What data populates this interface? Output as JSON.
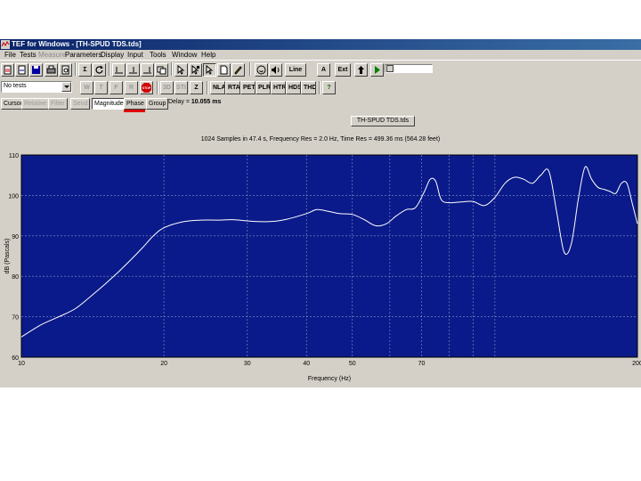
{
  "title_bar": {
    "text": "TEF for Windows - [TH-SPUD TDS.tds]"
  },
  "menu": [
    {
      "label": "File",
      "disabled": false
    },
    {
      "label": "Tests",
      "disabled": false
    },
    {
      "label": "Measure",
      "disabled": true
    },
    {
      "label": "Parameters",
      "disabled": false
    },
    {
      "label": "Display",
      "disabled": false
    },
    {
      "label": "Input",
      "disabled": false
    },
    {
      "label": "Tools",
      "disabled": false
    },
    {
      "label": "Window",
      "disabled": false
    },
    {
      "label": "Help",
      "disabled": false
    }
  ],
  "toolbar1": {
    "sum_label": "Σ",
    "line_label": "Line",
    "a_label": "A",
    "ext_label": "Ext"
  },
  "toolbar2": {
    "tests_dropdown": "No tests",
    "w_label": "W",
    "t_label": "T",
    "f_label": "F",
    "r_label": "R",
    "stop_label": "STOP",
    "3d_label": "3D",
    "sti_label": "STI",
    "z_label": "Z",
    "analysis_buttons": [
      "NLA",
      "RTA",
      "PET",
      "PLR",
      "HTR",
      "HDS",
      "THD"
    ],
    "help_label": "?"
  },
  "view_tabs": {
    "cursor": "Cursor",
    "relative": "Relative",
    "filter": "Filter",
    "send": "Send",
    "magnitude": "Magnitude",
    "phase": "Phase",
    "group": "Group",
    "delay_label": "Delay = ",
    "delay_value": "10.055 ms"
  },
  "document_tab": "TH-SPUD TDS.tds",
  "info_text": "1024 Samples in 47.4 s, Frequency Res = 2.0 Hz, Time Res = 499.36 ms (564.28 feet)",
  "colors": {
    "plot_bg": "#0a1a8a",
    "trace": "#ffffff",
    "grid": "#8a96c8",
    "phase_underline": "#e00000",
    "titlebar": "#0a246a"
  },
  "chart_data": {
    "type": "line",
    "xlabel": "Frequency (Hz)",
    "ylabel": "dB (Pascals)",
    "xscale": "log",
    "xlim": [
      10,
      200
    ],
    "ylim": [
      60,
      110
    ],
    "xticks": [
      10,
      20,
      30,
      40,
      50,
      70,
      200
    ],
    "yticks": [
      60,
      70,
      80,
      90,
      100,
      110
    ],
    "grid": true,
    "series": [
      {
        "name": "",
        "x": [
          10,
          11,
          12,
          13,
          14,
          15,
          16,
          17,
          18,
          19,
          20,
          22,
          24,
          26,
          28,
          30,
          33,
          36,
          40,
          42,
          44,
          47,
          50,
          53,
          56,
          59,
          62,
          65,
          68,
          71,
          73,
          75,
          77,
          80,
          85,
          90,
          95,
          100,
          105,
          110,
          115,
          120,
          125,
          130,
          135,
          140,
          145,
          150,
          155,
          160,
          165,
          170,
          175,
          180,
          185,
          190,
          195,
          200
        ],
        "y": [
          65,
          68,
          70,
          72,
          75,
          78,
          81,
          84,
          87,
          90,
          92,
          93.5,
          93.9,
          93.9,
          94,
          93.7,
          93.5,
          94,
          95.5,
          96.5,
          96.2,
          95.5,
          95.3,
          94,
          92.5,
          93,
          95,
          96.5,
          97,
          101,
          104,
          103.5,
          99,
          98.2,
          98.4,
          98.5,
          97.5,
          99.5,
          103,
          104.5,
          104,
          103,
          105,
          106,
          96,
          86,
          88,
          99,
          107,
          104,
          102,
          101.5,
          101,
          100.5,
          103,
          103,
          98,
          93
        ]
      }
    ]
  }
}
